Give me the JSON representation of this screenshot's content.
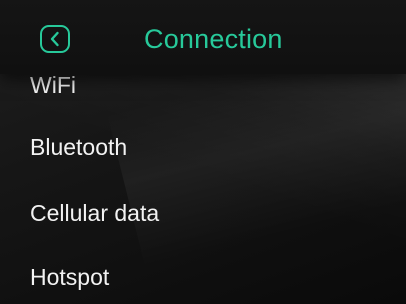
{
  "header": {
    "title": "Connection",
    "back_icon": "chevron-left-icon",
    "accent_color": "#27c99a"
  },
  "menu": {
    "items": [
      {
        "label": "WiFi"
      },
      {
        "label": "Bluetooth"
      },
      {
        "label": "Cellular data"
      },
      {
        "label": "Hotspot"
      }
    ]
  }
}
